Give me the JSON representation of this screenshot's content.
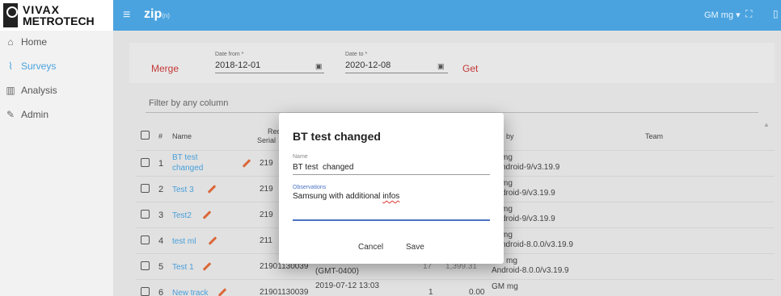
{
  "brand": {
    "line1": "VIVAX",
    "line2": "METROTECH"
  },
  "app": {
    "title": "zip",
    "subtitle": "(n)"
  },
  "user": {
    "menu_label": "GM mg ▾"
  },
  "sidebar": {
    "items": [
      {
        "label": "Home",
        "icon": "home-icon",
        "active": false
      },
      {
        "label": "Surveys",
        "icon": "surveys-icon",
        "active": true
      },
      {
        "label": "Analysis",
        "icon": "analysis-icon",
        "active": false
      },
      {
        "label": "Admin",
        "icon": "admin-icon",
        "active": false
      }
    ]
  },
  "toolbar": {
    "merge_label": "Merge",
    "date_from_label": "Date from *",
    "date_from_value": "2018-12-01",
    "date_to_label": "Date to *",
    "date_to_value": "2020-12-08",
    "get_label": "Get"
  },
  "filter": {
    "placeholder": "Filter by any column"
  },
  "table": {
    "headers": {
      "num": "#",
      "name": "Name",
      "rec_line1": "Rec",
      "rec_line2": "Serial",
      "created": "ated by",
      "team": "Team"
    },
    "rows": [
      {
        "num": "1",
        "name_line1": "BT test",
        "name_line2": "changed",
        "serial": "219",
        "created_line1": "mg",
        "created_line2": "ndroid-9/v3.19.9"
      },
      {
        "num": "2",
        "name_line1": "Test 3",
        "name_line2": "",
        "serial": "219",
        "created_line1": "mg",
        "created_line2": "droid-9/v3.19.9"
      },
      {
        "num": "3",
        "name_line1": "Test2",
        "name_line2": "",
        "serial": "219",
        "created_line1": "mg",
        "created_line2": "droid-9/v3.19.9"
      },
      {
        "num": "4",
        "name_line1": "test ml",
        "name_line2": "",
        "serial": "211",
        "created_line1": "mg",
        "created_line2": "ndroid-8.0.0/v3.19.9"
      },
      {
        "num": "5",
        "name_line1": "Test 1",
        "name_line2": "",
        "serial": "21901130039",
        "extra1": "(GMT-0400)",
        "extra2": "17",
        "extra3": "1,399.31",
        "created_line1": "mg",
        "created_line2": "Android-8.0.0/v3.19.9"
      },
      {
        "num": "6",
        "name_line1": "New track",
        "name_line2": "",
        "serial": "21901130039",
        "extra1": "2019-07-12 13:03",
        "extra2": "1",
        "extra3": "0.00",
        "created_line1": "GM mg",
        "created_line2": ""
      }
    ]
  },
  "dialog": {
    "title": "BT test changed",
    "name_label": "Name",
    "name_value": "BT test  changed",
    "observations_label": "Observations",
    "observations_value": "Samsung  with additional",
    "observations_value_misspelled": "infos",
    "cancel_label": "Cancel",
    "save_label": "Save"
  },
  "colors": {
    "topbar": "#4aa3df",
    "accent_link": "#4aa3df",
    "action_red": "#c83a3a",
    "focus": "#4a72c4"
  }
}
